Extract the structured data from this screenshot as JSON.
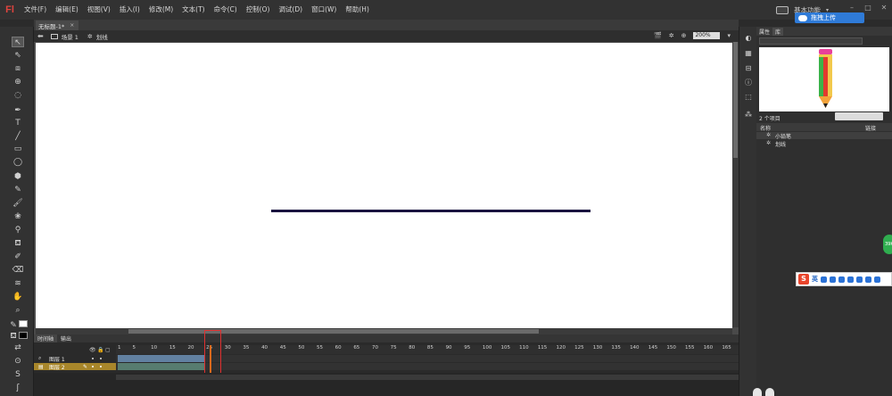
{
  "app": {
    "logo": "Fl"
  },
  "menu": [
    "文件(F)",
    "编辑(E)",
    "视图(V)",
    "插入(I)",
    "修改(M)",
    "文本(T)",
    "命令(C)",
    "控制(O)",
    "调试(D)",
    "窗口(W)",
    "帮助(H)"
  ],
  "workspace": {
    "label": "基本功能",
    "caret": "▾"
  },
  "upload_button": {
    "label": "拖拽上传"
  },
  "document": {
    "tab_title": "无标题-1*",
    "close_glyph": "×"
  },
  "scene_bar": {
    "scene_label": "场景 1",
    "symbol_label": "划线",
    "zoom": "200%"
  },
  "timeline": {
    "tabs": [
      "时间轴",
      "输出"
    ],
    "frame_ticks": [
      "1",
      "5",
      "10",
      "15",
      "20",
      "25",
      "30",
      "35",
      "40",
      "45",
      "50",
      "55",
      "60",
      "65",
      "70",
      "75",
      "80",
      "85",
      "90",
      "95",
      "100",
      "105",
      "110",
      "115",
      "120",
      "125",
      "130",
      "135",
      "140",
      "145",
      "150",
      "155",
      "160",
      "165"
    ],
    "layers": [
      {
        "name": "图层 1",
        "selected": false
      },
      {
        "name": "图层 2",
        "selected": true
      }
    ],
    "playhead_frame": 25
  },
  "library": {
    "tabs": [
      "属性",
      "库"
    ],
    "item_count": "2 个项目",
    "col_name": "名称",
    "col_link": "链接",
    "items": [
      {
        "name": "小铅笔",
        "icon": "symbol-icon"
      },
      {
        "name": "划线",
        "icon": "symbol-icon"
      }
    ]
  },
  "ime": {
    "logo": "S",
    "mode": "英"
  },
  "badge": {
    "label": "39K"
  },
  "colors": {
    "stage": "#ffffff",
    "line": "#1a1440",
    "accent_orange": "#e06a1c",
    "highlight_red": "#e03030",
    "upload_blue": "#2f7bd8"
  }
}
